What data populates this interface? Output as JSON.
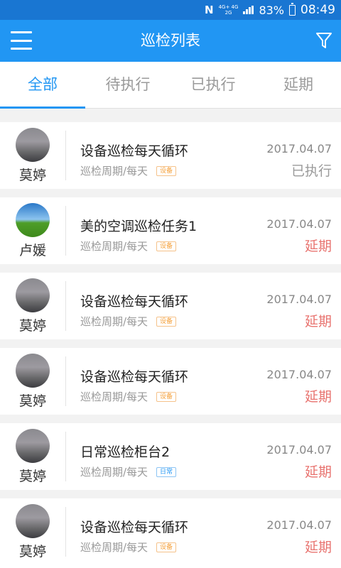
{
  "status_bar": {
    "network_top": "4G+ 4G",
    "network_bottom": "2G",
    "battery": "83%",
    "time": "08:49"
  },
  "header": {
    "title": "巡检列表"
  },
  "tabs": [
    {
      "label": "全部",
      "active": true
    },
    {
      "label": "待执行",
      "active": false
    },
    {
      "label": "已执行",
      "active": false
    },
    {
      "label": "延期",
      "active": false
    }
  ],
  "colors": {
    "primary": "#2196f3",
    "status_bar": "#1976d2",
    "done": "#9a9a9a",
    "overdue": "#e8736f",
    "tag_device": "#f5a03a",
    "tag_daily": "#2196f3"
  },
  "tasks": [
    {
      "user": "莫婷",
      "avatar": "gray-photo",
      "title": "设备巡检每天循环",
      "period": "巡检周期/每天",
      "tag": "设备",
      "tag_color": "orange",
      "date": "2017.04.07",
      "status": "已执行",
      "status_color": "#9a9a9a"
    },
    {
      "user": "卢媛",
      "avatar": "sky-photo",
      "title": "美的空调巡检任务1",
      "period": "巡检周期/每天",
      "tag": "设备",
      "tag_color": "orange",
      "date": "2017.04.07",
      "status": "延期",
      "status_color": "#e8736f"
    },
    {
      "user": "莫婷",
      "avatar": "gray-photo",
      "title": "设备巡检每天循环",
      "period": "巡检周期/每天",
      "tag": "设备",
      "tag_color": "orange",
      "date": "2017.04.07",
      "status": "延期",
      "status_color": "#e8736f"
    },
    {
      "user": "莫婷",
      "avatar": "gray-photo",
      "title": "设备巡检每天循环",
      "period": "巡检周期/每天",
      "tag": "设备",
      "tag_color": "orange",
      "date": "2017.04.07",
      "status": "延期",
      "status_color": "#e8736f"
    },
    {
      "user": "莫婷",
      "avatar": "gray-photo",
      "title": "日常巡检柜台2",
      "period": "巡检周期/每天",
      "tag": "日常",
      "tag_color": "blue",
      "date": "2017.04.07",
      "status": "延期",
      "status_color": "#e8736f"
    },
    {
      "user": "莫婷",
      "avatar": "gray-photo",
      "title": "设备巡检每天循环",
      "period": "巡检周期/每天",
      "tag": "设备",
      "tag_color": "orange",
      "date": "2017.04.07",
      "status": "延期",
      "status_color": "#e8736f"
    }
  ]
}
